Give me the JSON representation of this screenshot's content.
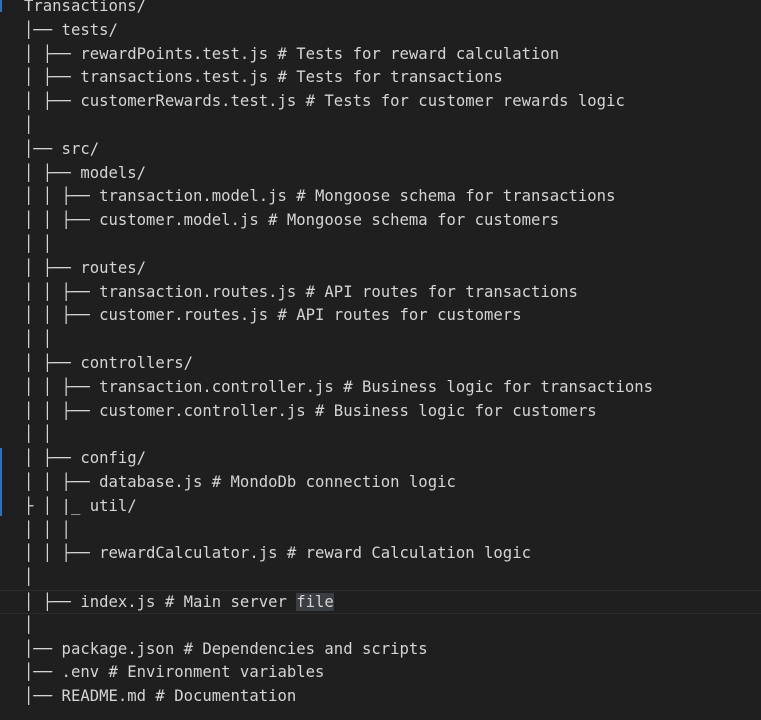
{
  "editor": {
    "lines": [
      "Transactions/",
      "│── tests/",
      "│ ├── rewardPoints.test.js # Tests for reward calculation",
      "│ ├── transactions.test.js # Tests for transactions",
      "│ ├── customerRewards.test.js # Tests for customer rewards logic",
      "│",
      "│── src/",
      "│ ├── models/",
      "│ │ ├── transaction.model.js # Mongoose schema for transactions",
      "│ │ ├── customer.model.js # Mongoose schema for customers",
      "│ │",
      "│ ├── routes/",
      "│ │ ├── transaction.routes.js # API routes for transactions",
      "│ │ ├── customer.routes.js # API routes for customers",
      "│ │",
      "│ ├── controllers/",
      "│ │ ├── transaction.controller.js # Business logic for transactions",
      "│ │ ├── customer.controller.js # Business logic for customers",
      "│ │",
      "│ ├── config/",
      "│ │ ├── database.js # MondoDb connection logic",
      "├ │ |_ util/",
      "│ │ │",
      "│ │ ├── rewardCalculator.js # reward Calculation logic",
      "│",
      "│ ├── index.js # Main server file",
      "│",
      "│── package.json # Dependencies and scripts",
      "│── .env # Environment variables",
      "│── README.md # Documentation"
    ],
    "highlight": {
      "before": "│ ├── index.js # Main server ",
      "word": "file"
    }
  }
}
